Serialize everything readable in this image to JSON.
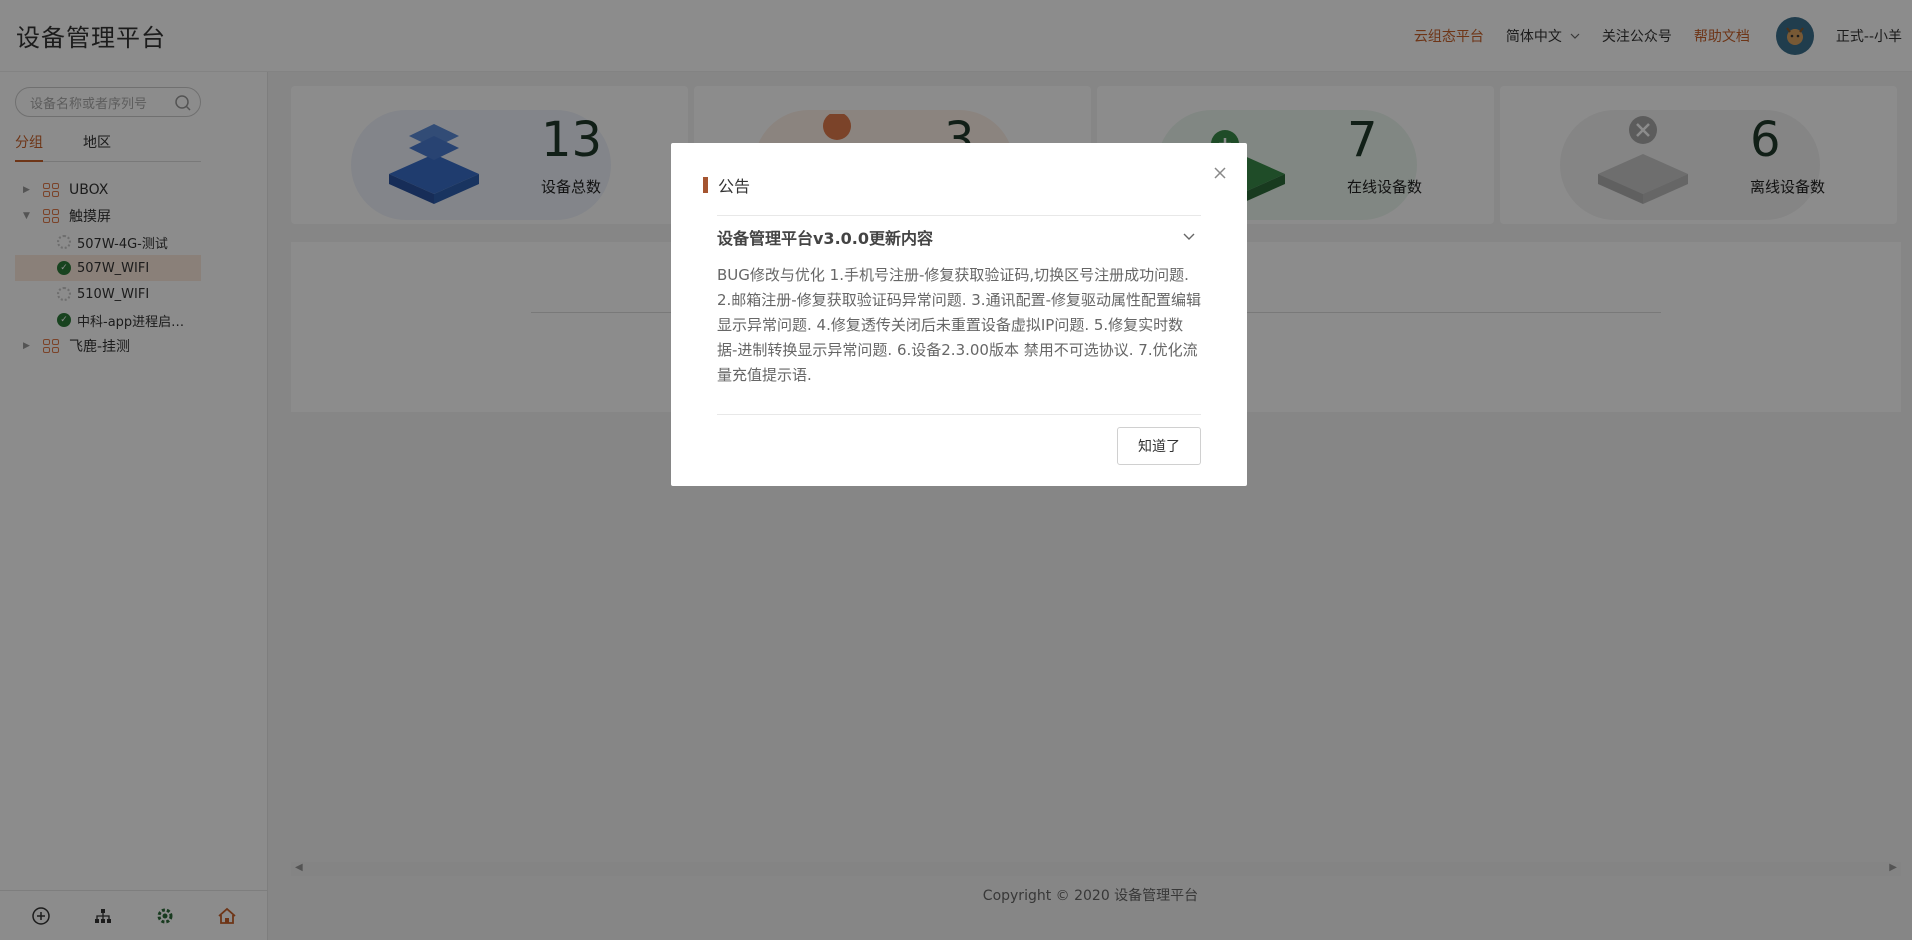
{
  "header": {
    "title": "设备管理平台",
    "links": {
      "cloud_platform": "云组态平台",
      "language": "简体中文",
      "follow": "关注公众号",
      "help": "帮助文档",
      "user": "正式--小羊"
    }
  },
  "sidebar": {
    "search_placeholder": "设备名称或者序列号",
    "tabs": [
      "分组",
      "地区"
    ],
    "tree": [
      {
        "label": "UBOX",
        "level": 1,
        "expanded": false
      },
      {
        "label": "触摸屏",
        "level": 1,
        "expanded": true
      },
      {
        "label": "507W-4G-测试",
        "level": 2,
        "status": "offline"
      },
      {
        "label": "507W_WIFI",
        "level": 2,
        "status": "online",
        "selected": true
      },
      {
        "label": "510W_WIFI",
        "level": 2,
        "status": "offline"
      },
      {
        "label": "中科-app进程启…",
        "level": 2,
        "status": "online"
      },
      {
        "label": "飞鹿-挂测",
        "level": 1,
        "expanded": false
      }
    ],
    "footer_icons": [
      "add-circle-icon",
      "org-tree-icon",
      "settings-icon",
      "home-icon"
    ]
  },
  "stats": [
    {
      "value": "13",
      "label": "设备总数",
      "color": "#3a6ec8"
    },
    {
      "value": "3",
      "label": "",
      "color": "#e07b4c"
    },
    {
      "value": "7",
      "label": "在线设备数",
      "color": "#3a8a4a"
    },
    {
      "value": "6",
      "label": "离线设备数",
      "color": "#b0b0b0"
    }
  ],
  "footer": {
    "copyright": "Copyright © 2020 设备管理平台"
  },
  "modal": {
    "title": "公告",
    "panel_title": "设备管理平台v3.0.0更新内容",
    "body": "BUG修改与优化 1.手机号注册-修复获取验证码,切换区号注册成功问题. 2.邮箱注册-修复获取验证码异常问题. 3.通讯配置-修复驱动属性配置编辑显示异常问题. 4.修复透传关闭后未重置设备虚拟IP问题. 5.修复实时数据-进制转换显示异常问题. 6.设备2.3.00版本 禁用不可选协议. 7.优化流量充值提示语.",
    "ok_label": "知道了"
  },
  "colors": {
    "accent": "#c8622a",
    "modal_bar": "#a55530"
  }
}
